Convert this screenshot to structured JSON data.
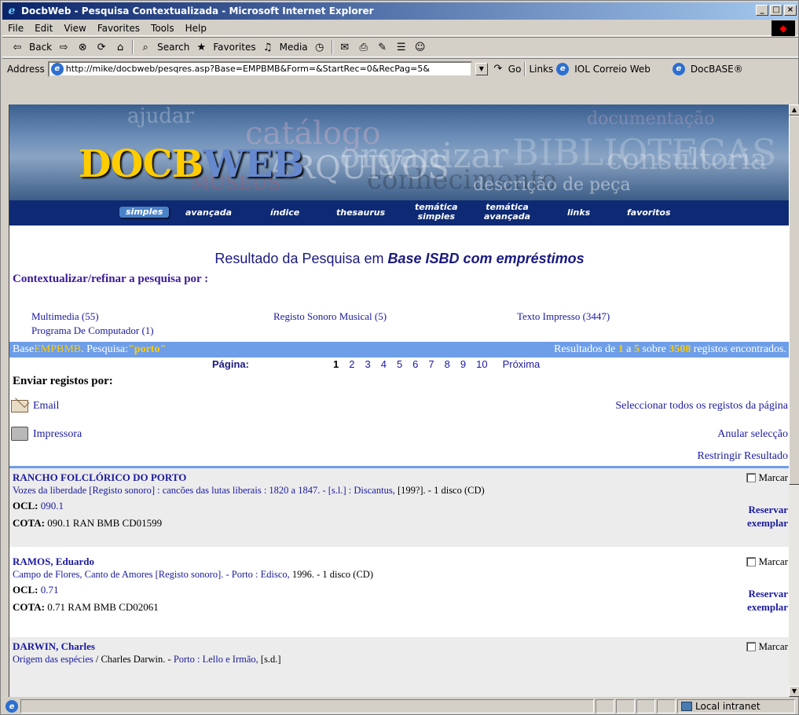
{
  "window": {
    "title": "DocbWeb - Pesquisa Contextualizada - Microsoft Internet Explorer",
    "controls": [
      "minimize-icon",
      "maximize-icon",
      "close-icon"
    ]
  },
  "menubar": {
    "items": [
      "File",
      "Edit",
      "View",
      "Favorites",
      "Tools",
      "Help"
    ]
  },
  "toolbar": {
    "back_label": "Back",
    "search_label": "Search",
    "favorites_label": "Favorites",
    "media_label": "Media"
  },
  "addressbar": {
    "label": "Address",
    "url": "http://mike/docbweb/pesqres.asp?Base=EMPBMB&Form=&StartRec=0&RecPag=5&",
    "go_label": "Go",
    "links_label": "Links",
    "link1": "IOL Correio Web",
    "link2": "DocBASE®"
  },
  "banner": {
    "logo_a": "DOCB",
    "logo_b": "WEB",
    "ghost_words": [
      "ajudar",
      "catálogo",
      "organizar",
      "BIBLIOTECAS",
      "documentação",
      "consultoria",
      "ARQUIVOS",
      "conhecimento",
      "descrição de peça",
      "MUSEUS"
    ]
  },
  "nav": {
    "simples": "simples",
    "avancada": "avançada",
    "indice": "índice",
    "thesaurus": "thesaurus",
    "tematica_simples_1": "temática",
    "tematica_simples_2": "simples",
    "tematica_avancada_1": "temática",
    "tematica_avancada_2": "avançada",
    "links": "links",
    "favoritos": "favoritos"
  },
  "results": {
    "title_prefix": "Resultado da Pesquisa em ",
    "base_name": "Base ISBD com empréstimos",
    "ctx_heading": "Contextualizar/refinar a pesquisa por :",
    "ctx_items": [
      "Multimedia (55)",
      "Registo Sonoro Musical (5)",
      "Texto Impresso (3447)",
      "Programa De Computador (1)"
    ],
    "info_base_label": "Base ",
    "info_base": "EMPBMB",
    "info_query_label": ". Pesquisa: ",
    "info_query": "\"porto\"",
    "info_results_label": "Resultados de ",
    "info_from": "1",
    "info_a": " a ",
    "info_to": "5",
    "info_sobre": " sobre ",
    "info_total": "3508",
    "info_tail": " registos encontrados.",
    "page_label": "Página:",
    "pages": [
      "1",
      "2",
      "3",
      "4",
      "5",
      "6",
      "7",
      "8",
      "9",
      "10"
    ],
    "next_label": "Próxima",
    "send_heading": "Enviar registos por:",
    "email_label": "Email",
    "printer_label": "Impressora",
    "select_all": "Seleccionar todos os registos da página",
    "cancel_selection": "Anular selecção",
    "restrict": "Restringir Resultado"
  },
  "records": [
    {
      "author": "RANCHO FOLCLÓRICO DO PORTO",
      "desc_link": "Vozes da liberdade [Registo sonoro] : cancões das lutas liberais : 1820 a 1847. - [s.l.] : Discantus, ",
      "desc_plain": "[199?]. - 1 disco (CD)",
      "ocl_label": "OCL:",
      "ocl": "090.1",
      "cota_label": "COTA:",
      "cota": "090.1 RAN  BMB  CD01599",
      "marcar": "Marcar",
      "reserve_1": "Reservar",
      "reserve_2": "exemplar"
    },
    {
      "author": "RAMOS, Eduardo",
      "desc_link": "Campo de Flores, Canto de Amores [Registo sonoro]. - Porto : Edisco, ",
      "desc_plain": "1996. - 1 disco (CD)",
      "ocl_label": "OCL:",
      "ocl": "0.71",
      "cota_label": "COTA:",
      "cota": "0.71 RAM  BMB  CD02061",
      "marcar": "Marcar",
      "reserve_1": "Reservar",
      "reserve_2": "exemplar"
    },
    {
      "author": "DARWIN, Charles",
      "desc_link": "Origem das espécies",
      "desc_plain": " / Charles Darwin. - ",
      "desc_link2": "Porto : Lello e Irmão,",
      "desc_plain2": " [s.d.]",
      "marcar": "Marcar"
    }
  ],
  "statusbar": {
    "zone": "Local intranet"
  }
}
